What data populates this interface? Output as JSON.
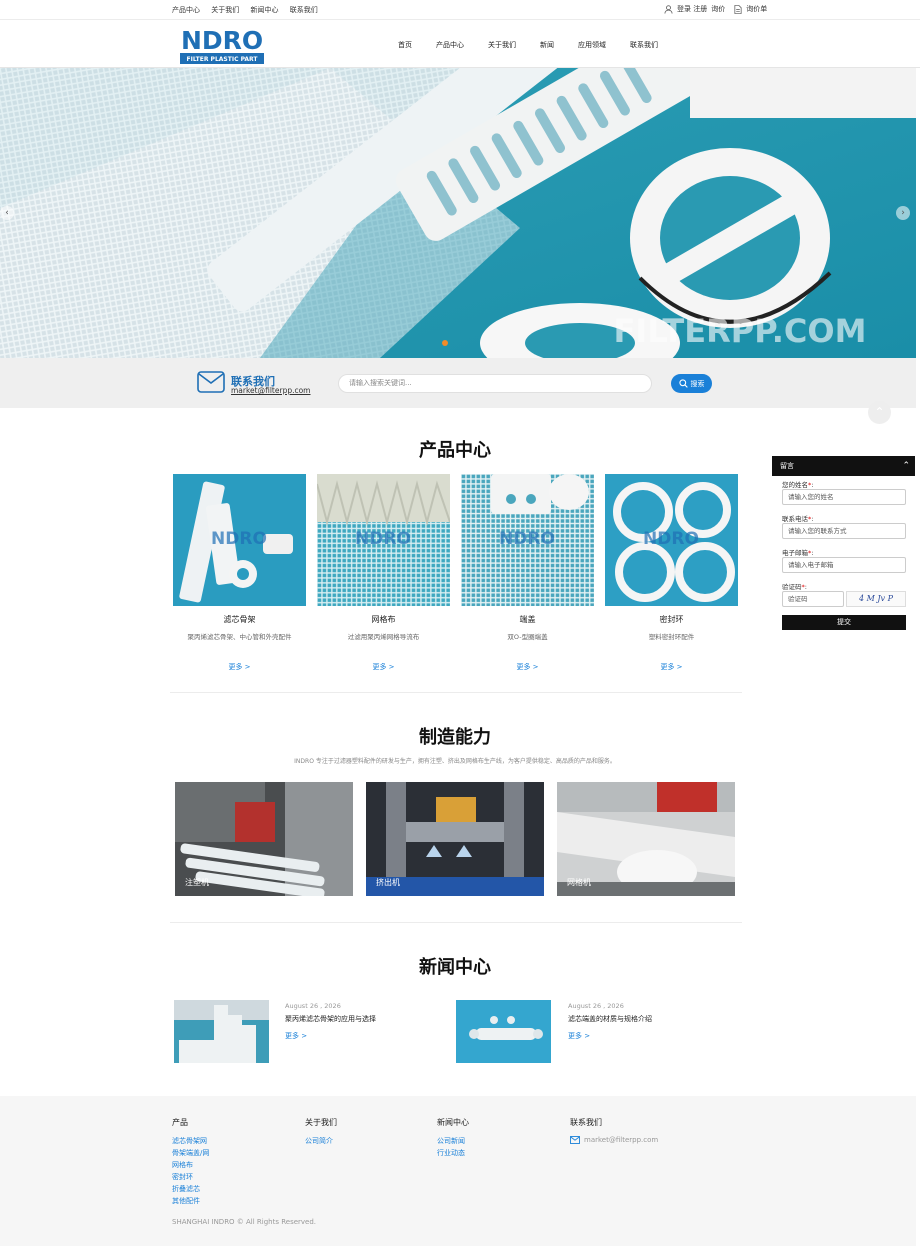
{
  "topbar": {
    "links": [
      "产品中心",
      "关于我们",
      "新闻中心",
      "联系我们"
    ],
    "login": "登录 注册",
    "cart": "询价",
    "inquiry": "询价单"
  },
  "logo": {
    "brand": "NDRO",
    "sub": "FILTER PLASTIC PART",
    "color": "#1f6fb5"
  },
  "nav": [
    "首页",
    "产品中心",
    "关于我们",
    "新闻",
    "应用领域",
    "联系我们"
  ],
  "banner": {
    "watermark": "FILTERPP.COM"
  },
  "contact": {
    "title": "联系我们",
    "email": "market@filterpp.com"
  },
  "search": {
    "placeholder": "请输入搜索关键词...",
    "button": "搜索"
  },
  "products": {
    "title": "产品中心",
    "items": [
      {
        "name": "滤芯骨架",
        "desc": "聚丙烯滤芯骨架、中心管和外壳配件",
        "more": "更多 >"
      },
      {
        "name": "网格布",
        "desc": "过滤用聚丙烯网格导流布",
        "more": "更多 >"
      },
      {
        "name": "端盖",
        "desc": "双O-型圈端盖",
        "more": "更多 >"
      },
      {
        "name": "密封环",
        "desc": "塑料密封环配件",
        "more": "更多 >"
      }
    ]
  },
  "capability": {
    "title": "制造能力",
    "intro": "INDRO 专注于过滤器塑料配件的研发与生产，拥有注塑、挤出及网格布生产线，为客户提供稳定、高品质的产品和服务。",
    "items": [
      {
        "label": "注塑机"
      },
      {
        "label": "挤出机"
      },
      {
        "label": "网格机"
      }
    ]
  },
  "news": {
    "title": "新闻中心",
    "items": [
      {
        "date": "August 26 , 2026",
        "title": "聚丙烯滤芯骨架的应用与选择",
        "more": "更多 >"
      },
      {
        "date": "August 26 , 2026",
        "title": "滤芯端盖的材质与规格介绍",
        "more": "更多 >"
      }
    ]
  },
  "footer": {
    "col1": {
      "title": "产品",
      "links": [
        "滤芯骨架网",
        "骨架端盖/网",
        "网格布",
        "密封环",
        "折叠滤芯",
        "其他配件"
      ]
    },
    "col2": {
      "title": "关于我们",
      "links": [
        "公司简介"
      ]
    },
    "col3": {
      "title": "新闻中心",
      "links": [
        "公司新闻",
        "行业动态"
      ]
    },
    "col4": {
      "title": "联系我们",
      "email": "market@filterpp.com"
    },
    "copyright": "SHANGHAI INDRO © All Rights Reserved."
  },
  "widget": {
    "title": "留言",
    "fields": [
      {
        "label": "您的姓名",
        "placeholder": "请输入您的姓名"
      },
      {
        "label": "联系电话",
        "placeholder": "请输入您的联系方式"
      },
      {
        "label": "电子邮箱",
        "placeholder": "请输入电子邮箱"
      }
    ],
    "captcha_label": "验证码",
    "captcha_placeholder": "验证码",
    "captcha_image_text": "4 M Jv P",
    "submit": "提交"
  }
}
